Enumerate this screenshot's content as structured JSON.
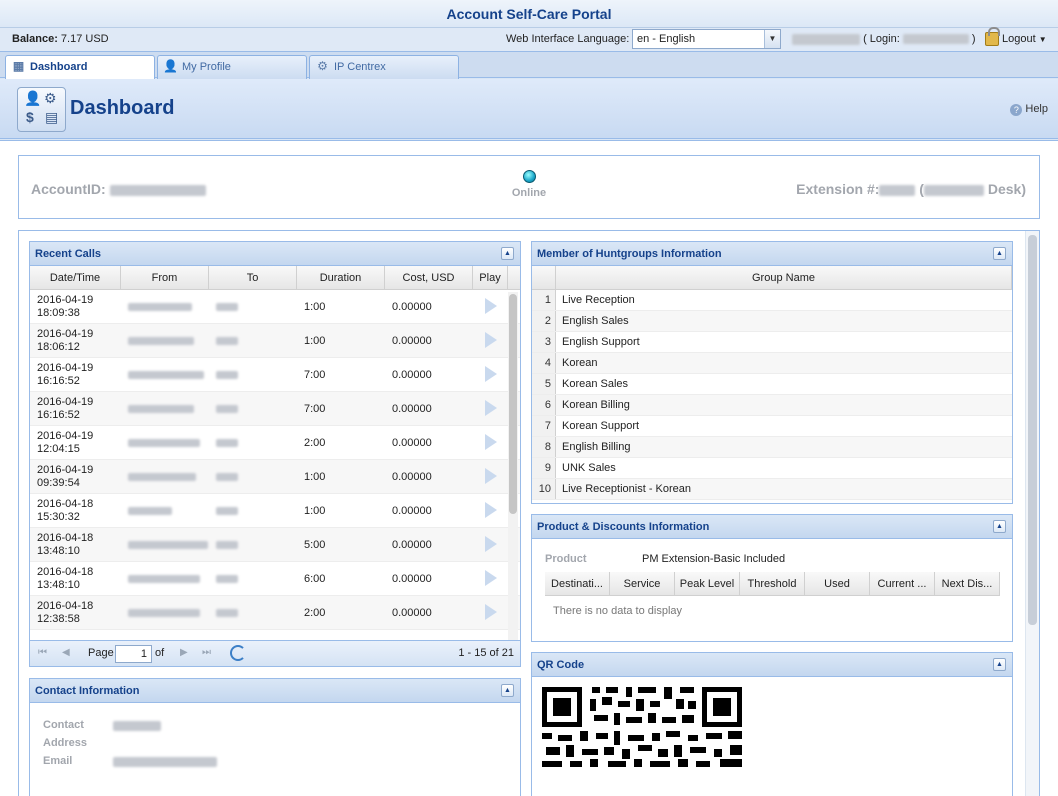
{
  "app": {
    "title": "Account Self-Care Portal"
  },
  "infobar": {
    "balance_label": "Balance:",
    "balance_value": "7.17 USD",
    "language_label": "Web Interface Language:",
    "language_value": "en - English",
    "login_prefix": "( Login:",
    "login_suffix": ")",
    "logout_label": "Logout"
  },
  "tabs": [
    {
      "label": "Dashboard",
      "icon": "dashboard-icon",
      "active": true
    },
    {
      "label": "My Profile",
      "icon": "user-icon",
      "active": false
    },
    {
      "label": "IP Centrex",
      "icon": "gear-icon",
      "active": false
    }
  ],
  "page": {
    "title": "Dashboard",
    "help_label": "Help"
  },
  "account": {
    "id_label": "AccountID:",
    "status": "Online",
    "extension_label": "Extension #:",
    "extension_paren_open": "(",
    "extension_desk": "Desk)"
  },
  "recent_calls": {
    "title": "Recent Calls",
    "columns": [
      "Date/Time",
      "From",
      "To",
      "Duration",
      "Cost, USD",
      "Play"
    ],
    "rows": [
      {
        "date": "2016-04-19",
        "time": "18:09:38",
        "duration": "1:00",
        "cost": "0.00000"
      },
      {
        "date": "2016-04-19",
        "time": "18:06:12",
        "duration": "1:00",
        "cost": "0.00000"
      },
      {
        "date": "2016-04-19",
        "time": "16:16:52",
        "duration": "7:00",
        "cost": "0.00000"
      },
      {
        "date": "2016-04-19",
        "time": "16:16:52",
        "duration": "7:00",
        "cost": "0.00000"
      },
      {
        "date": "2016-04-19",
        "time": "12:04:15",
        "duration": "2:00",
        "cost": "0.00000"
      },
      {
        "date": "2016-04-19",
        "time": "09:39:54",
        "duration": "1:00",
        "cost": "0.00000"
      },
      {
        "date": "2016-04-18",
        "time": "15:30:32",
        "duration": "1:00",
        "cost": "0.00000"
      },
      {
        "date": "2016-04-18",
        "time": "13:48:10",
        "duration": "5:00",
        "cost": "0.00000"
      },
      {
        "date": "2016-04-18",
        "time": "13:48:10",
        "duration": "6:00",
        "cost": "0.00000"
      },
      {
        "date": "2016-04-18",
        "time": "12:38:58",
        "duration": "2:00",
        "cost": "0.00000"
      }
    ],
    "pager": {
      "page_label": "Page",
      "page_value": "1",
      "of_label": "of",
      "summary": "1 - 15 of 21"
    }
  },
  "contact": {
    "title": "Contact Information",
    "labels": [
      "Contact",
      "Address",
      "Email"
    ]
  },
  "huntgroups": {
    "title": "Member of Huntgroups Information",
    "column": "Group Name",
    "rows": [
      {
        "num": "1",
        "name": "Live Reception"
      },
      {
        "num": "2",
        "name": "English Sales"
      },
      {
        "num": "3",
        "name": "English Support"
      },
      {
        "num": "4",
        "name": "Korean"
      },
      {
        "num": "5",
        "name": "Korean Sales"
      },
      {
        "num": "6",
        "name": "Korean Billing"
      },
      {
        "num": "7",
        "name": "Korean Support"
      },
      {
        "num": "8",
        "name": "English Billing"
      },
      {
        "num": "9",
        "name": "UNK Sales"
      },
      {
        "num": "10",
        "name": "Live Receptionist - Korean"
      }
    ]
  },
  "product": {
    "title": "Product & Discounts Information",
    "product_label": "Product",
    "product_value": "PM Extension-Basic Included",
    "columns": [
      "Destinati...",
      "Service",
      "Peak Level",
      "Threshold",
      "Used",
      "Current ...",
      "Next Dis..."
    ],
    "empty_text": "There is no data to display"
  },
  "qr": {
    "title": "QR Code"
  },
  "colors": {
    "accent": "#15428b",
    "panel_border": "#99bbe8",
    "header_bg": "#dae7f6"
  }
}
